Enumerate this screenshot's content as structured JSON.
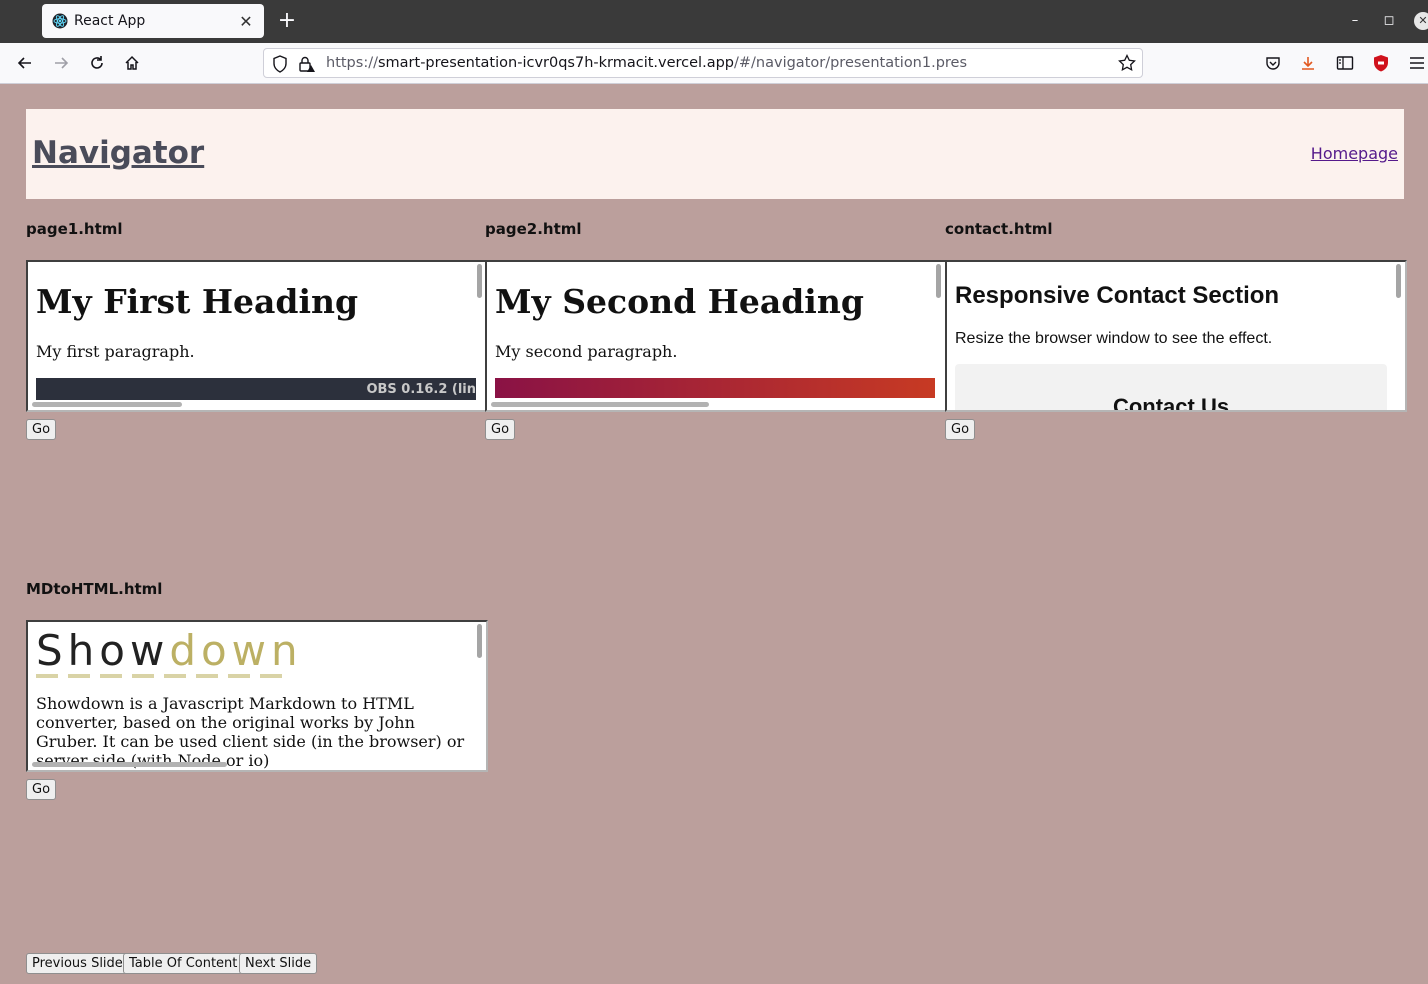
{
  "browser": {
    "tab_title": "React App",
    "url_prefix": "https://",
    "url_host": "smart-presentation-icvr0qs7h-krmacit.vercel.app",
    "url_path": "/#/navigator/presentation1.pres",
    "new_tab_symbol": "+"
  },
  "header": {
    "title": "Navigator",
    "link": "Homepage"
  },
  "cells": [
    {
      "label": "page1.html",
      "heading": "My First Heading",
      "paragraph": "My first paragraph.",
      "bar_text": "OBS 0.16.2 (lin",
      "go": "Go"
    },
    {
      "label": "page2.html",
      "heading": "My Second Heading",
      "paragraph": "My second paragraph.",
      "go": "Go"
    },
    {
      "label": "contact.html",
      "heading": "Responsive Contact Section",
      "paragraph": "Resize the browser window to see the effect.",
      "box_title": "Contact Us",
      "go": "Go"
    },
    {
      "label": "MDtoHTML.html",
      "logo_head": "Show",
      "logo_tail": "down",
      "paragraph": "Showdown is a Javascript Markdown to HTML converter, based on the original works by John Gruber. It can be used client side (in the browser) or server side (with Node or io)",
      "go": "Go"
    }
  ],
  "footer": {
    "previous": "Previous Slide",
    "toc": "Table Of Content",
    "next": "Next Slide"
  },
  "colors": {
    "page_background": "#bb9f9c",
    "header_background": "#fcf2ee",
    "showdown_accent": "#bcb064"
  }
}
